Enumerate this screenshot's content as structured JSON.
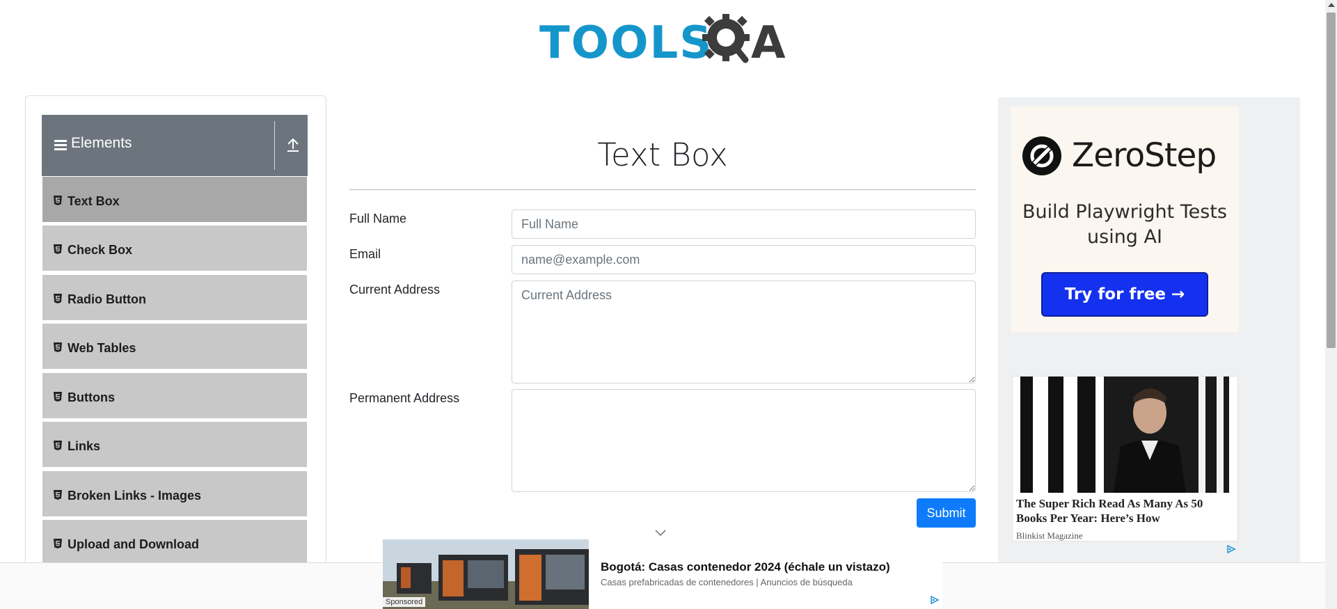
{
  "header": {
    "logo_text_left": "TOOLS",
    "logo_text_right": "A"
  },
  "sidebar": {
    "group_title": "Elements",
    "items": [
      {
        "label": "Text Box",
        "active": true
      },
      {
        "label": "Check Box"
      },
      {
        "label": "Radio Button"
      },
      {
        "label": "Web Tables"
      },
      {
        "label": "Buttons"
      },
      {
        "label": "Links"
      },
      {
        "label": "Broken Links - Images"
      },
      {
        "label": "Upload and Download"
      }
    ]
  },
  "main": {
    "title": "Text Box",
    "fields": {
      "full_name": {
        "label": "Full Name",
        "placeholder": "Full Name",
        "value": ""
      },
      "email": {
        "label": "Email",
        "placeholder": "name@example.com",
        "value": ""
      },
      "current_address": {
        "label": "Current Address",
        "placeholder": "Current Address",
        "value": ""
      },
      "permanent_address": {
        "label": "Permanent Address",
        "placeholder": "",
        "value": ""
      }
    },
    "submit_label": "Submit"
  },
  "right_ad": {
    "brand": "ZeroStep",
    "tagline": "Build Playwright Tests using AI",
    "cta": "Try for free →",
    "article_title": "The Super Rich Read As Many As 50 Books Per Year: Here’s How",
    "article_source": "Blinkist Magazine"
  },
  "bottom_ad": {
    "sponsored": "Sponsored",
    "title": "Bogotá: Casas contenedor 2024 (échale un vistazo)",
    "subtitle": "Casas prefabricadas de contenedores | Anuncios de búsqueda"
  },
  "colors": {
    "accent": "#0d7bfb",
    "sidebar_header": "#6c757d",
    "menu_item": "#c8c8c8",
    "menu_item_active": "#a8a8a8",
    "logo_blue": "#1596cb"
  }
}
